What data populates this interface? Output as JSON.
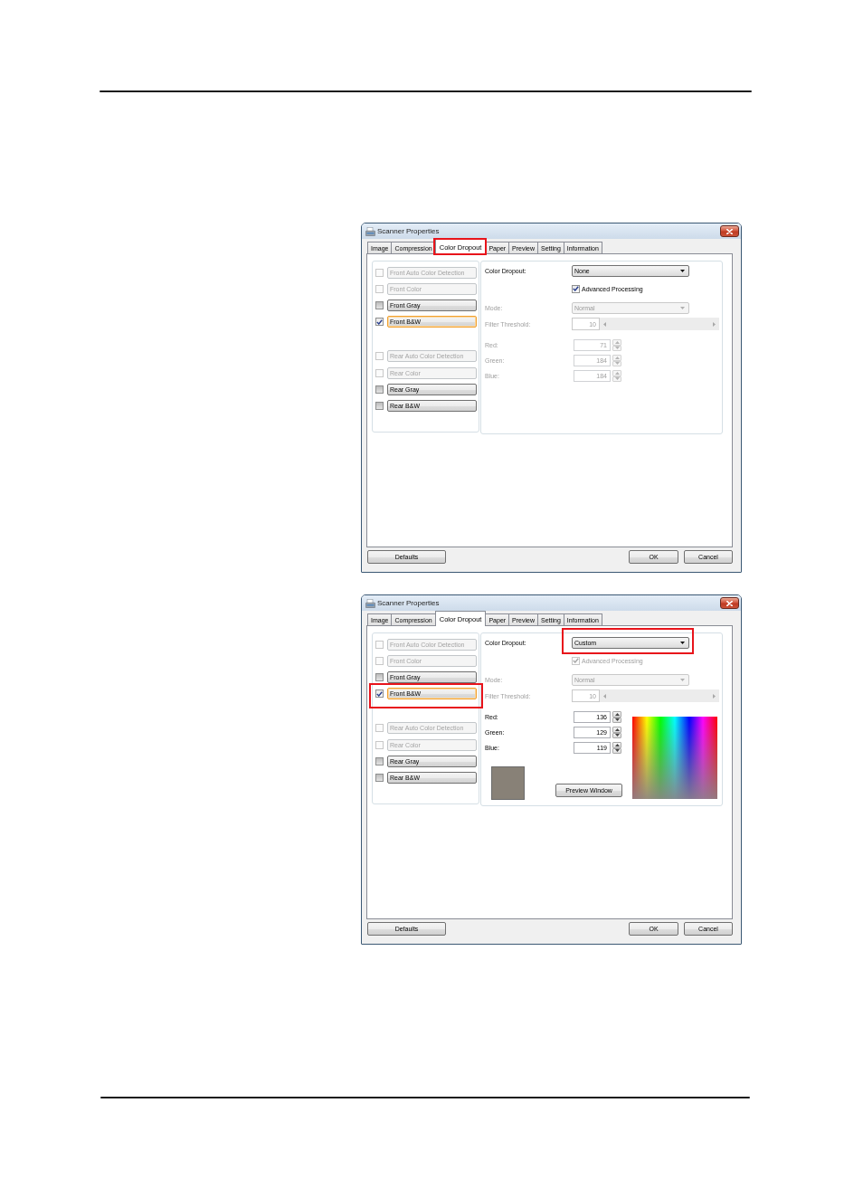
{
  "dialogs": [
    {
      "title": "Scanner Properties",
      "tabs": [
        {
          "label": "Image",
          "selected": false,
          "highlighted": false
        },
        {
          "label": "Compression",
          "selected": false,
          "highlighted": false
        },
        {
          "label": "Color Dropout",
          "selected": true,
          "highlighted": true
        },
        {
          "label": "Paper",
          "selected": false,
          "highlighted": false
        },
        {
          "label": "Preview",
          "selected": false,
          "highlighted": false
        },
        {
          "label": "Setting",
          "selected": false,
          "highlighted": false
        },
        {
          "label": "Information",
          "selected": false,
          "highlighted": false
        }
      ],
      "channel_groups": [
        {
          "items": [
            {
              "label": "Front Auto Color Detection",
              "checked": false,
              "disabled": true,
              "selected": false,
              "highlighted": false
            },
            {
              "label": "Front Color",
              "checked": false,
              "disabled": true,
              "selected": false,
              "highlighted": false
            },
            {
              "label": "Front Gray",
              "checked": false,
              "disabled": false,
              "selected": false,
              "highlighted": false
            },
            {
              "label": "Front B&W",
              "checked": true,
              "disabled": false,
              "selected": true,
              "highlighted": false
            }
          ]
        },
        {
          "items": [
            {
              "label": "Rear Auto Color Detection",
              "checked": false,
              "disabled": true,
              "selected": false,
              "highlighted": false
            },
            {
              "label": "Rear Color",
              "checked": false,
              "disabled": true,
              "selected": false,
              "highlighted": false
            },
            {
              "label": "Rear Gray",
              "checked": false,
              "disabled": false,
              "selected": false,
              "highlighted": false
            },
            {
              "label": "Rear B&W",
              "checked": false,
              "disabled": false,
              "selected": false,
              "highlighted": false
            }
          ]
        }
      ],
      "color_dropout": {
        "label": "Color Dropout:",
        "value": "None",
        "highlighted": false
      },
      "advanced_processing": {
        "label": "Advanced Processing",
        "checked": true,
        "disabled": false
      },
      "mode": {
        "label": "Mode:",
        "value": "Normal",
        "disabled": true
      },
      "filter_threshold": {
        "label": "Filter Threshold:",
        "value": "10",
        "disabled": true
      },
      "rgb": {
        "disabled": true,
        "fields": [
          {
            "label": "Red:",
            "value": "71"
          },
          {
            "label": "Green:",
            "value": "184"
          },
          {
            "label": "Blue:",
            "value": "184"
          }
        ]
      },
      "buttons": [
        {
          "kind": "defaults",
          "label": "Defaults"
        },
        {
          "kind": "ok",
          "label": "OK"
        },
        {
          "kind": "cancel",
          "label": "Cancel"
        }
      ]
    },
    {
      "title": "Scanner Properties",
      "tabs": [
        {
          "label": "Image",
          "selected": false,
          "highlighted": false
        },
        {
          "label": "Compression",
          "selected": false,
          "highlighted": false
        },
        {
          "label": "Color Dropout",
          "selected": true,
          "highlighted": false
        },
        {
          "label": "Paper",
          "selected": false,
          "highlighted": false
        },
        {
          "label": "Preview",
          "selected": false,
          "highlighted": false
        },
        {
          "label": "Setting",
          "selected": false,
          "highlighted": false
        },
        {
          "label": "Information",
          "selected": false,
          "highlighted": false
        }
      ],
      "channel_groups": [
        {
          "items": [
            {
              "label": "Front Auto Color Detection",
              "checked": false,
              "disabled": true,
              "selected": false,
              "highlighted": false
            },
            {
              "label": "Front Color",
              "checked": false,
              "disabled": true,
              "selected": false,
              "highlighted": false
            },
            {
              "label": "Front Gray",
              "checked": false,
              "disabled": false,
              "selected": false,
              "highlighted": false
            },
            {
              "label": "Front B&W",
              "checked": true,
              "disabled": false,
              "selected": true,
              "highlighted": true
            }
          ]
        },
        {
          "items": [
            {
              "label": "Rear Auto Color Detection",
              "checked": false,
              "disabled": true,
              "selected": false,
              "highlighted": false
            },
            {
              "label": "Rear Color",
              "checked": false,
              "disabled": true,
              "selected": false,
              "highlighted": false
            },
            {
              "label": "Rear Gray",
              "checked": false,
              "disabled": false,
              "selected": false,
              "highlighted": false
            },
            {
              "label": "Rear B&W",
              "checked": false,
              "disabled": false,
              "selected": false,
              "highlighted": false
            }
          ]
        }
      ],
      "color_dropout": {
        "label": "Color Dropout:",
        "value": "Custom",
        "highlighted": true
      },
      "advanced_processing": {
        "label": "Advanced Processing",
        "checked": true,
        "disabled": true
      },
      "mode": {
        "label": "Mode:",
        "value": "Normal",
        "disabled": true
      },
      "filter_threshold": {
        "label": "Filter Threshold:",
        "value": "10",
        "disabled": true
      },
      "rgb": {
        "disabled": false,
        "fields": [
          {
            "label": "Red:",
            "value": "136"
          },
          {
            "label": "Green:",
            "value": "129"
          },
          {
            "label": "Blue:",
            "value": "119"
          }
        ]
      },
      "custom": {
        "button": "Preview Window"
      },
      "buttons": [
        {
          "kind": "defaults",
          "label": "Defaults"
        },
        {
          "kind": "ok",
          "label": "OK"
        },
        {
          "kind": "cancel",
          "label": "Cancel"
        }
      ]
    }
  ]
}
